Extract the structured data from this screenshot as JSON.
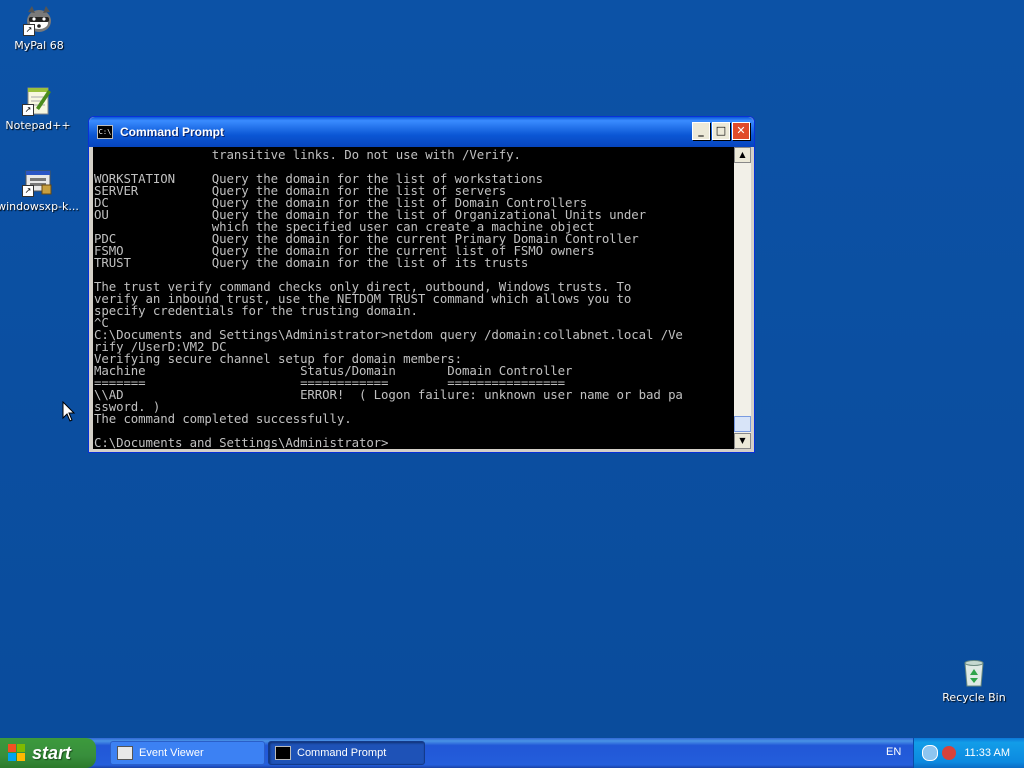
{
  "desktop": {
    "icons": [
      {
        "label": "MyPal 68",
        "icon": "raccoon-icon"
      },
      {
        "label": "Notepad++",
        "icon": "notepad-icon"
      },
      {
        "label": "windowsxp-k...",
        "icon": "installer-icon"
      },
      {
        "label": "Recycle Bin",
        "icon": "recycle-bin-icon"
      }
    ]
  },
  "window": {
    "title": "Command Prompt",
    "buttons": {
      "minimize": "_",
      "maximize": "□",
      "close": "✕"
    },
    "console_lines": [
      "                transitive links. Do not use with /Verify.",
      "",
      "WORKSTATION     Query the domain for the list of workstations",
      "SERVER          Query the domain for the list of servers",
      "DC              Query the domain for the list of Domain Controllers",
      "OU              Query the domain for the list of Organizational Units under",
      "                which the specified user can create a machine object",
      "PDC             Query the domain for the current Primary Domain Controller",
      "FSMO            Query the domain for the current list of FSMO owners",
      "TRUST           Query the domain for the list of its trusts",
      "",
      "The trust verify command checks only direct, outbound, Windows trusts. To",
      "verify an inbound trust, use the NETDOM TRUST command which allows you to",
      "specify credentials for the trusting domain.",
      "^C",
      "C:\\Documents and Settings\\Administrator>netdom query /domain:collabnet.local /Ve",
      "rify /UserD:VM2 DC",
      "Verifying secure channel setup for domain members:",
      "Machine                     Status/Domain       Domain Controller",
      "=======                     ============        ================",
      "\\\\AD                        ERROR!  ( Logon failure: unknown user name or bad pa",
      "ssword. )",
      "The command completed successfully.",
      "",
      "C:\\Documents and Settings\\Administrator>"
    ]
  },
  "taskbar": {
    "start_label": "start",
    "tasks": [
      {
        "label": "Event Viewer",
        "active": false
      },
      {
        "label": "Command Prompt",
        "active": true
      }
    ],
    "language": "EN",
    "clock": "11:33 AM"
  }
}
